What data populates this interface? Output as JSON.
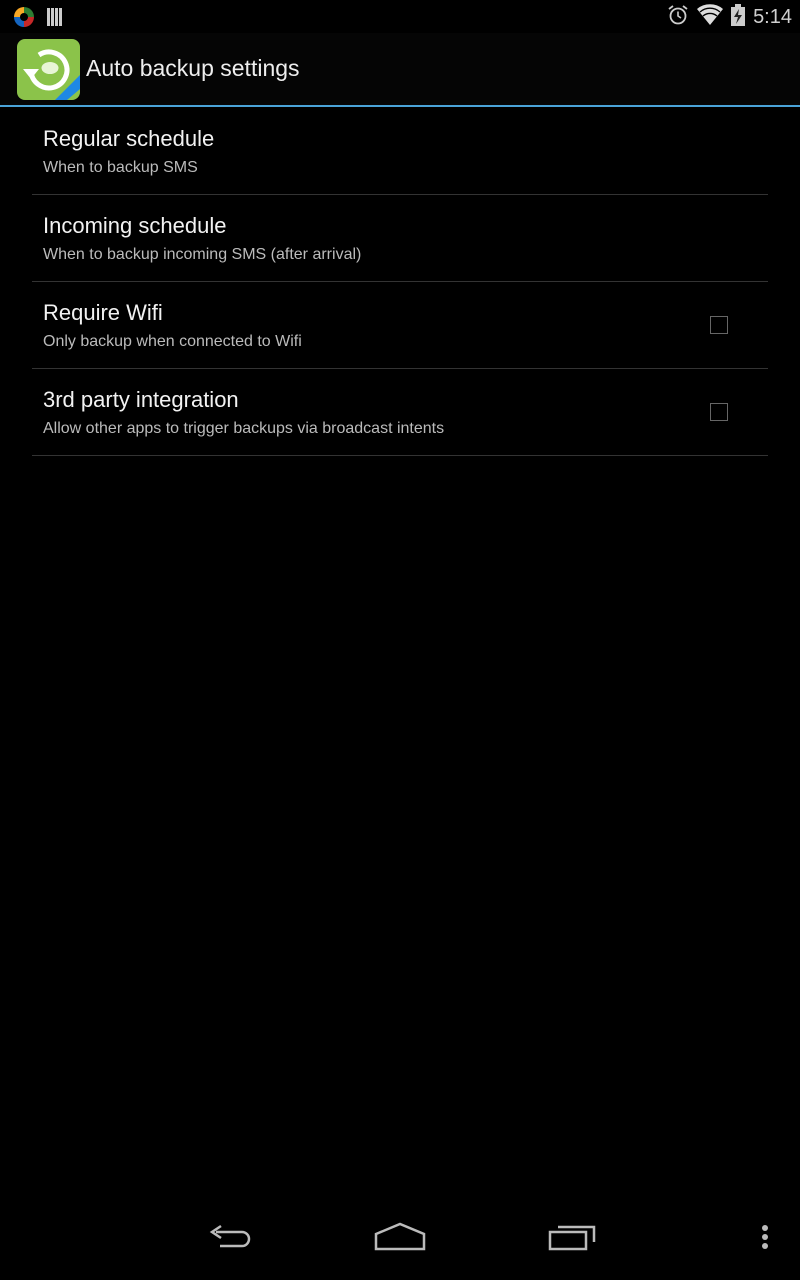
{
  "status_bar": {
    "left_icons": [
      "app-notification-icon",
      "barcode-icon"
    ],
    "right_icons": [
      "alarm-icon",
      "wifi-icon",
      "battery-charging-icon"
    ],
    "time": "5:14"
  },
  "action_bar": {
    "app_icon": "sms-backup-pro-app-icon",
    "title": "Auto backup settings",
    "accent_color": "#4aa3d8"
  },
  "settings": [
    {
      "title": "Regular schedule",
      "summary": "When to backup SMS",
      "has_checkbox": false
    },
    {
      "title": "Incoming schedule",
      "summary": "When to backup incoming SMS (after arrival)",
      "has_checkbox": false
    },
    {
      "title": "Require Wifi",
      "summary": "Only backup when connected to Wifi",
      "has_checkbox": true,
      "checked": false
    },
    {
      "title": "3rd party integration",
      "summary": "Allow other apps to trigger backups via broadcast intents",
      "has_checkbox": true,
      "checked": false
    }
  ],
  "navbar": {
    "buttons": [
      "back-icon",
      "home-icon",
      "recents-icon",
      "overflow-menu-icon"
    ]
  }
}
